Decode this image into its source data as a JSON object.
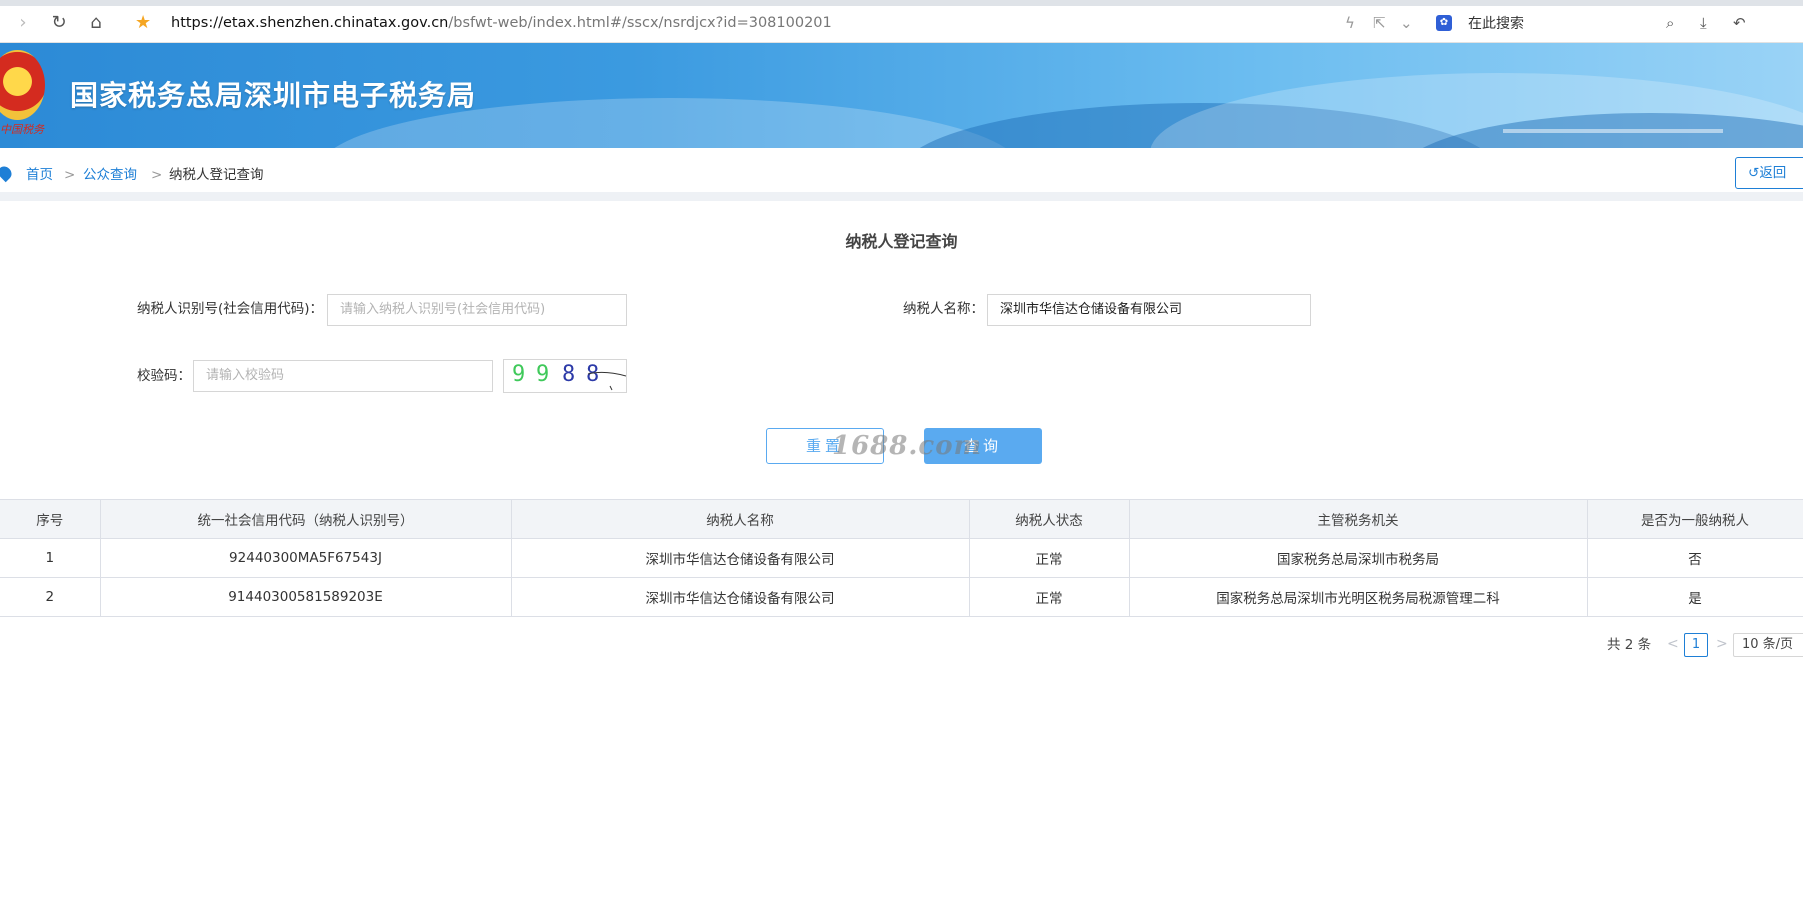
{
  "browser": {
    "url_host": "https://etax.shenzhen.chinatax.gov.cn",
    "url_path": "/bsfwt-web/index.html#/sscx/nsrdjcx?id=308100201",
    "search_placeholder": "在此搜索"
  },
  "banner": {
    "title": "国家税务总局深圳市电子税务局",
    "emblem_text": "中国税务"
  },
  "breadcrumb": {
    "home": "首页",
    "sep": ">",
    "public_query": "公众查询",
    "current": "纳税人登记查询",
    "back": "返回"
  },
  "form": {
    "title": "纳税人登记查询",
    "taxpayer_id_label": "纳税人识别号(社会信用代码)：",
    "taxpayer_id_placeholder": "请输入纳税人识别号(社会信用代码)",
    "taxpayer_name_label": "纳税人名称：",
    "taxpayer_name_value": "深圳市华信达仓储设备有限公司",
    "captcha_label": "校验码：",
    "captcha_placeholder": "请输入校验码",
    "captcha_chars": [
      "9",
      "9",
      "8",
      "8"
    ],
    "reset": "重置",
    "query": "查询",
    "watermark": "1688.com"
  },
  "table": {
    "headers": [
      "序号",
      "统一社会信用代码（纳税人识别号）",
      "纳税人名称",
      "纳税人状态",
      "主管税务机关",
      "是否为一般纳税人"
    ],
    "rows": [
      [
        "1",
        "92440300MA5F67543J",
        "深圳市华信达仓储设备有限公司",
        "正常",
        "国家税务总局深圳市税务局",
        "否"
      ],
      [
        "2",
        "91440300581589203E",
        "深圳市华信达仓储设备有限公司",
        "正常",
        "国家税务总局深圳市光明区税务局税源管理二科",
        "是"
      ]
    ]
  },
  "pager": {
    "total": "共 2 条",
    "prev": "<",
    "page": "1",
    "next": ">",
    "page_size": "10 条/页"
  },
  "colors": {
    "accent": "#1e7fd6",
    "button": "#5aaaf0"
  }
}
